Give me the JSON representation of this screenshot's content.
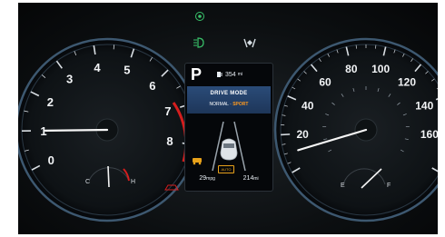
{
  "tachometer": {
    "ticks": [
      "0",
      "1",
      "2",
      "3",
      "4",
      "5",
      "6",
      "7",
      "8"
    ],
    "needle_value": 1
  },
  "fuel_temp": {
    "left_labels": [
      "C",
      "H"
    ],
    "right_labels": [
      "E",
      "F"
    ]
  },
  "speedometer": {
    "ticks": [
      "20",
      "40",
      "60",
      "80",
      "100",
      "120",
      "140",
      "160"
    ],
    "needle_value": 10
  },
  "center_screen": {
    "gear": "P",
    "range_top": "354",
    "mode_title": "DRIVE MODE",
    "mode_line_prefix": "NORMAL ·",
    "mode_value": "SPORT",
    "bottom_left": "29",
    "bottom_right": "214"
  },
  "colors": {
    "accent_red": "#d41e1e",
    "sport_orange": "#ff9a1f",
    "indicator_green": "#39c36a",
    "screen_blue": "#2a4b78"
  }
}
